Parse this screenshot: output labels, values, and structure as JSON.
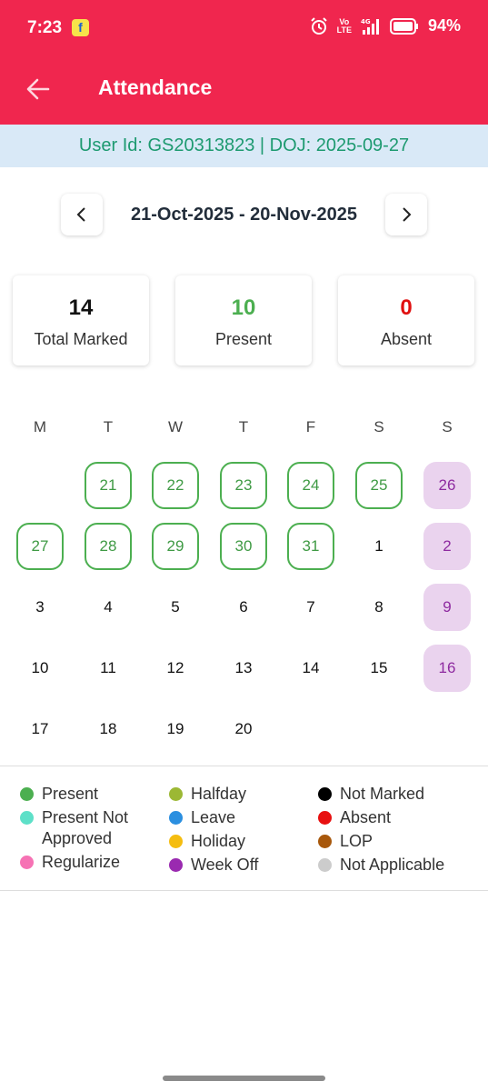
{
  "status": {
    "time": "7:23",
    "lte_label": "Vo\nLTE",
    "network_label": "4G",
    "battery": "94%",
    "icons": [
      "flipkart-icon",
      "alarm-icon",
      "signal-icon",
      "battery-icon"
    ]
  },
  "appbar": {
    "title": "Attendance",
    "back_icon": "arrow-left-icon",
    "color": "#f0264e"
  },
  "user_info": "User Id: GS20313823 | DOJ: 2025-09-27",
  "range": {
    "label": "21-Oct-2025 - 20-Nov-2025",
    "prev_icon": "chevron-left-icon",
    "next_icon": "chevron-right-icon"
  },
  "stats": [
    {
      "value": "14",
      "label": "Total Marked",
      "color": "#111111"
    },
    {
      "value": "10",
      "label": "Present",
      "color": "#4caf50"
    },
    {
      "value": "0",
      "label": "Absent",
      "color": "#e01010"
    }
  ],
  "calendar": {
    "weekdays": [
      "M",
      "T",
      "W",
      "T",
      "F",
      "S",
      "S"
    ],
    "days": [
      {
        "label": "21",
        "status": "present"
      },
      {
        "label": "22",
        "status": "present"
      },
      {
        "label": "23",
        "status": "present"
      },
      {
        "label": "24",
        "status": "present"
      },
      {
        "label": "25",
        "status": "present"
      },
      {
        "label": "26",
        "status": "weekoff"
      },
      {
        "label": "27",
        "status": "present"
      },
      {
        "label": "28",
        "status": "present"
      },
      {
        "label": "29",
        "status": "present"
      },
      {
        "label": "30",
        "status": "present"
      },
      {
        "label": "31",
        "status": "present"
      },
      {
        "label": "1",
        "status": "none"
      },
      {
        "label": "2",
        "status": "weekoff"
      },
      {
        "label": "3",
        "status": "none"
      },
      {
        "label": "4",
        "status": "none"
      },
      {
        "label": "5",
        "status": "none"
      },
      {
        "label": "6",
        "status": "none"
      },
      {
        "label": "7",
        "status": "none"
      },
      {
        "label": "8",
        "status": "none"
      },
      {
        "label": "9",
        "status": "weekoff"
      },
      {
        "label": "10",
        "status": "none"
      },
      {
        "label": "11",
        "status": "none"
      },
      {
        "label": "12",
        "status": "none"
      },
      {
        "label": "13",
        "status": "none"
      },
      {
        "label": "14",
        "status": "none"
      },
      {
        "label": "15",
        "status": "none"
      },
      {
        "label": "16",
        "status": "weekoff"
      },
      {
        "label": "17",
        "status": "none"
      },
      {
        "label": "18",
        "status": "none"
      },
      {
        "label": "19",
        "status": "none"
      },
      {
        "label": "20",
        "status": "none"
      }
    ]
  },
  "legend": [
    {
      "label": "Present",
      "color": "#4caf50"
    },
    {
      "label": "Present Not\nApproved",
      "color": "#5ee0c8"
    },
    {
      "label": "Regularize",
      "color": "#f672b4"
    },
    {
      "label": "Halfday",
      "color": "#9cb834"
    },
    {
      "label": "Leave",
      "color": "#2b8fe0"
    },
    {
      "label": "Holiday",
      "color": "#f5bd10"
    },
    {
      "label": "Week Off",
      "color": "#9a2ab0"
    },
    {
      "label": "Not Marked",
      "color": "#000000"
    },
    {
      "label": "Absent",
      "color": "#e81010"
    },
    {
      "label": "LOP",
      "color": "#a8580c"
    },
    {
      "label": "Not Applicable",
      "color": "#cccccc"
    }
  ]
}
